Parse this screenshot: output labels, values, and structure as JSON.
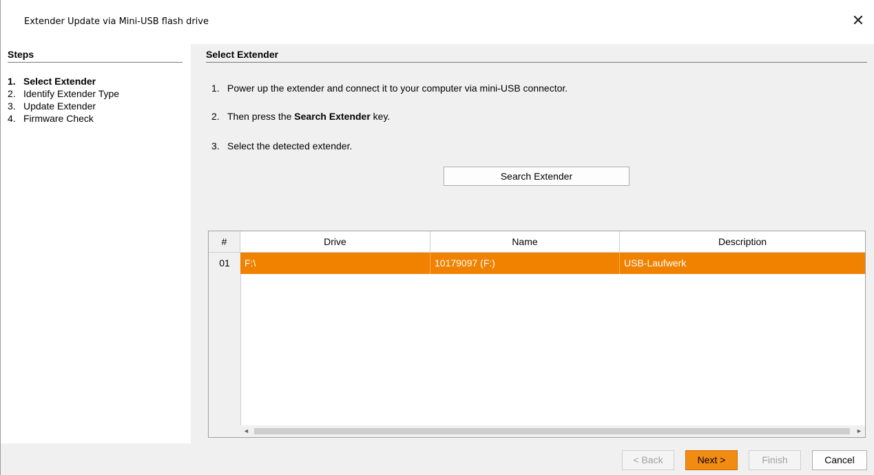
{
  "window": {
    "title": "Extender Update via Mini-USB flash drive",
    "close_glyph": "✕"
  },
  "steps": {
    "header": "Steps",
    "items": [
      {
        "num": "1.",
        "label": "Select Extender"
      },
      {
        "num": "2.",
        "label": "Identify Extender Type"
      },
      {
        "num": "3.",
        "label": "Update Extender"
      },
      {
        "num": "4.",
        "label": "Firmware Check"
      }
    ]
  },
  "main": {
    "header": "Select Extender",
    "instructions": [
      {
        "num": "1.",
        "text": "Power up the extender and connect it to your computer via mini-USB connector."
      },
      {
        "num": "2.",
        "pre": "Then press the ",
        "bold": "Search Extender",
        "post": " key."
      },
      {
        "num": "3.",
        "text": "Select the detected extender."
      }
    ],
    "search_button": "Search Extender"
  },
  "table": {
    "columns": [
      "#",
      "Drive",
      "Name",
      "Description"
    ],
    "rows": [
      {
        "num": "01",
        "drive": "F:\\",
        "name": "10179097 (F:)",
        "description": "USB-Laufwerk",
        "selected": true
      }
    ],
    "selection_color": "#f08200",
    "scroll_left": "◄",
    "scroll_right": "►"
  },
  "buttons": {
    "back": "< Back",
    "next": "Next >",
    "finish": "Finish",
    "cancel": "Cancel"
  },
  "colors": {
    "accent": "#f28b11"
  }
}
